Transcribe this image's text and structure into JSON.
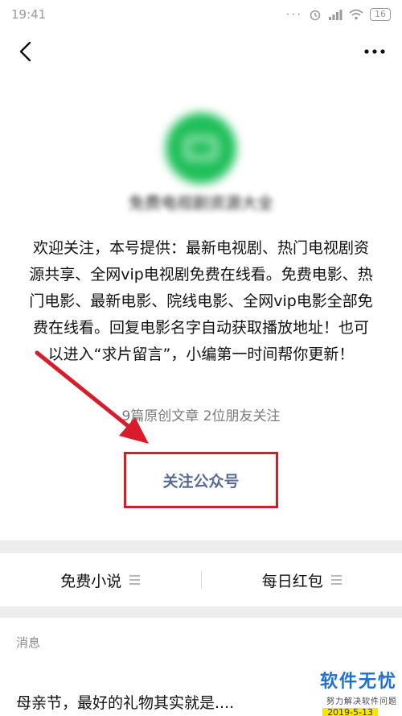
{
  "status_bar": {
    "time": "19:41",
    "battery": "16"
  },
  "account": {
    "name": "免费电视剧资源大全"
  },
  "intro": "欢迎关注，本号提供：最新电视剧、热门电视剧资源共享、全网vip电视剧免费在线看。免费电影、热门电影、最新电影、院线电影、全网vip电影全部免费在线看。回复电影名字自动获取播放地址！也可以进入“求片留言”，小编第一时间帮你更新！",
  "meta": "9篇原创文章  2位朋友关注",
  "follow_button": "关注公众号",
  "menu": [
    {
      "label": "免费小说"
    },
    {
      "label": "每日红包"
    }
  ],
  "messages": {
    "section_label": "消息",
    "first_title": "母亲节，最好的礼物其实就是...."
  },
  "watermark": {
    "title": "软件无忧",
    "subtitle": "努力解决软件问题",
    "date": "2019-5-13"
  },
  "colors": {
    "highlight_border": "#d81c2b",
    "link": "#576b95",
    "avatar": "#1fbf5a",
    "watermark_blue": "#1f6fd6"
  },
  "icons": [
    "back-arrow-icon",
    "more-dots-icon",
    "tv-icon",
    "menu-lines-icon",
    "signal-icon",
    "wifi-icon",
    "alarm-icon",
    "battery-icon"
  ]
}
